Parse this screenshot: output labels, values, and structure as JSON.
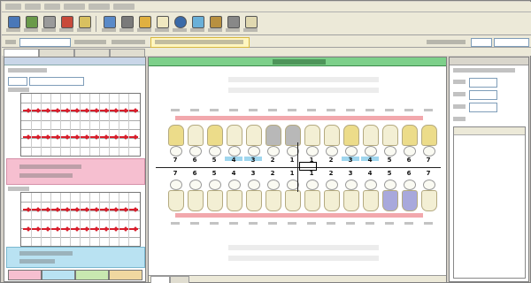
{
  "chart": {
    "upper_numbers": [
      "7",
      "6",
      "5",
      "4",
      "3",
      "2",
      "1",
      "1",
      "2",
      "3",
      "4",
      "5",
      "6",
      "7"
    ],
    "lower_numbers": [
      "7",
      "6",
      "5",
      "4",
      "3",
      "2",
      "1",
      "1",
      "2",
      "3",
      "4",
      "5",
      "6",
      "7"
    ]
  },
  "colors": {
    "chart_header": "#7dd08a",
    "caries_mark": "#d81e2c",
    "pink_section": "#f6bfd0",
    "blue_section": "#b9e2f2",
    "selection": "#000000"
  },
  "icons": [
    "new-record-icon",
    "find-icon",
    "print-icon",
    "save-icon",
    "calendar-icon",
    "chart-icon",
    "xray-icon",
    "report-icon",
    "eye-icon",
    "image-icon",
    "export-icon",
    "settings-icon",
    "close-icon"
  ]
}
